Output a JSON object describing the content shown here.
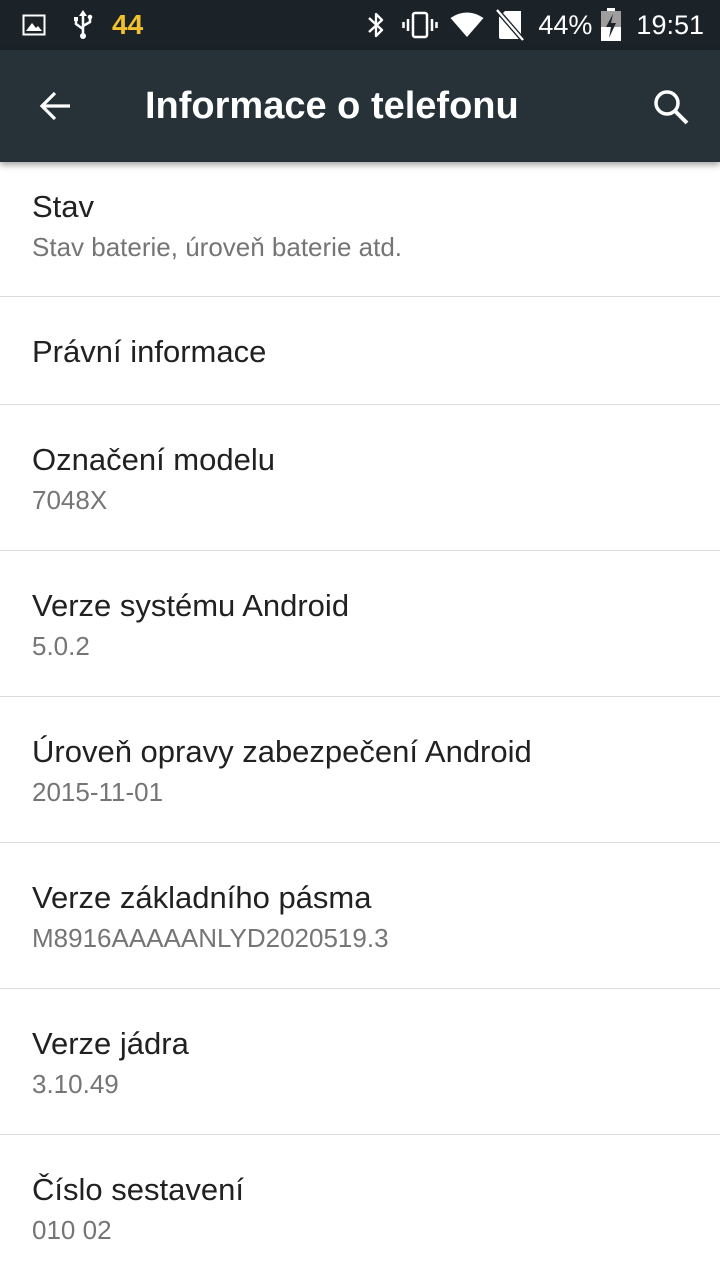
{
  "status_bar": {
    "notification_count": "44",
    "battery_percent": "44%",
    "time": "19:51",
    "icons": [
      "image-icon",
      "usb-icon",
      "bluetooth-icon",
      "vibrate-icon",
      "wifi-icon",
      "no-sim-icon",
      "battery-charging-icon"
    ]
  },
  "app_bar": {
    "title": "Informace o telefonu",
    "back_icon": "arrow-back-icon",
    "search_icon": "search-icon"
  },
  "items": [
    {
      "title": "Stav",
      "subtitle": "Stav baterie, úroveň baterie atd."
    },
    {
      "title": "Právní informace",
      "subtitle": ""
    },
    {
      "title": "Označení modelu",
      "subtitle": "7048X"
    },
    {
      "title": "Verze systému Android",
      "subtitle": "5.0.2"
    },
    {
      "title": "Úroveň opravy zabezpečení Android",
      "subtitle": "2015-11-01"
    },
    {
      "title": "Verze základního pásma",
      "subtitle": "M8916AAAAANLYD2020519.3"
    },
    {
      "title": "Verze jádra",
      "subtitle": "3.10.49"
    },
    {
      "title": "Číslo sestavení",
      "subtitle": "010 02"
    }
  ],
  "colors": {
    "status_bar": "#1b2328",
    "app_bar": "#263238",
    "notification_number": "#f2c12e",
    "divider": "#dcdcdc",
    "title_text": "#212121",
    "subtitle_text": "#757575"
  }
}
